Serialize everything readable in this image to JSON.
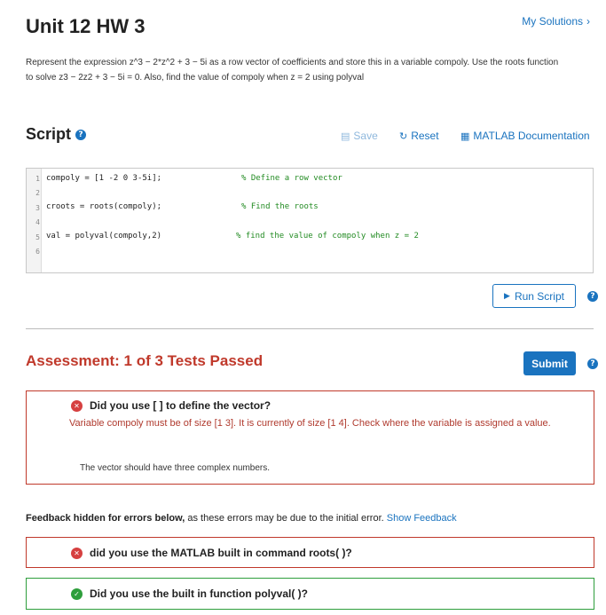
{
  "header": {
    "title": "Unit 12 HW 3",
    "my_solutions": "My Solutions",
    "chevron": "›"
  },
  "problem": {
    "text": "Represent the expression z^3 − 2*z^2 + 3 − 5i as a row vector of coefficients and store this in a variable compoly. Use the roots function to solve z3 − 2z2 + 3 − 5i = 0. Also, find the value of compoly when z = 2 using polyval"
  },
  "script": {
    "title": "Script",
    "help_glyph": "?",
    "save_label": "Save",
    "reset_label": "Reset",
    "docs_label": "MATLAB Documentation",
    "run_label": "Run Script",
    "line_numbers": [
      "1",
      "2",
      "3",
      "4",
      "5",
      "6"
    ],
    "code": {
      "line1": "compoly = [1 -2 0 3-5i];",
      "line1_comment": "% Define a row vector",
      "line3": "croots = roots(compoly);",
      "line3_comment": "% Find the roots",
      "line5": "val = polyval(compoly,2)",
      "line5_comment": "% find the value of compoly when z = 2"
    }
  },
  "assessment": {
    "title": "Assessment: 1 of 3 Tests Passed",
    "submit_label": "Submit",
    "tests": [
      {
        "title": "Did you use [ ] to define the vector?",
        "status": "fail",
        "message": "Variable compoly must be of size [1 3]. It is currently of size [1 4]. Check where the variable is assigned a value.",
        "note": "The vector should have three complex numbers."
      },
      {
        "title": "did you use the MATLAB built in command roots( )?",
        "status": "fail"
      },
      {
        "title": "Did you use the built in function polyval( )?",
        "status": "pass"
      }
    ],
    "feedback_bold": "Feedback hidden for errors below,",
    "feedback_rest": " as these errors may be due to the initial error. ",
    "feedback_link": "Show Feedback"
  },
  "colors": {
    "accent": "#1a73bf",
    "error": "#c0392b",
    "success": "#2e9e3c",
    "comment": "#228b22"
  },
  "icons": {
    "fail": "x-circle-icon",
    "pass": "check-circle-icon"
  }
}
